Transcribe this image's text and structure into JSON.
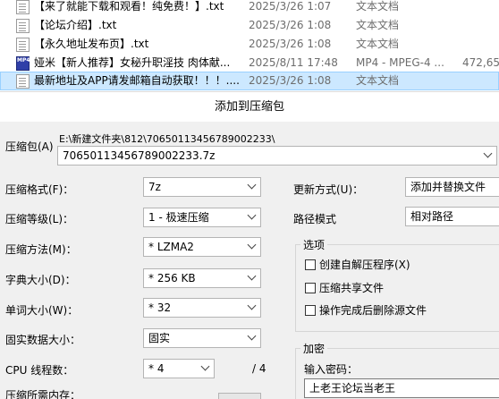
{
  "files": [
    {
      "icon": "text-file-icon",
      "name": "【来了就能下载和观看！纯免费！】.txt",
      "date": "2025/3/26 1:07",
      "type": "文本文档",
      "size": ""
    },
    {
      "icon": "text-file-icon",
      "name": "【论坛介绍】.txt",
      "date": "2025/3/26 1:08",
      "type": "文本文档",
      "size": ""
    },
    {
      "icon": "text-file-icon",
      "name": "【永久地址发布页】.txt",
      "date": "2025/3/26 1:08",
      "type": "文本文档",
      "size": ""
    },
    {
      "icon": "video-file-icon",
      "name": "娅米【新人推荐】女秘升职淫技 肉体献...",
      "date": "2025/8/11 17:48",
      "type": "MP4 - MPEG-4 ...",
      "size": "472,65"
    },
    {
      "icon": "text-file-icon",
      "name": "最新地址及APP请发邮箱自动获取！！！....",
      "date": "2025/3/26 1:08",
      "type": "文本文档",
      "size": ""
    }
  ],
  "mp4_icon_text": "MP4",
  "dialog": {
    "title": "添加到压缩包",
    "archive_label": "压缩包(A)",
    "archive_path": "E:\\新建文件夹\\812\\70650113456789002233\\",
    "archive_name": "70650113456789002233.7z",
    "format_label": "压缩格式(F)：",
    "format_value": "7z",
    "level_label": "压缩等级(L)：",
    "level_value": "1 - 极速压缩",
    "method_label": "压缩方法(M)：",
    "method_value": "* LZMA2",
    "dict_label": "字典大小(D)：",
    "dict_value": "* 256 KB",
    "word_label": "单词大小(W)：",
    "word_value": "* 32",
    "solid_label": "固实数据大小：",
    "solid_value": "固实",
    "threads_label": "CPU 线程数：",
    "threads_value": "* 4",
    "threads_total": "/ 4",
    "memory_label": "压缩所需内存：",
    "update_label": "更新方式(U)：",
    "update_value": "添加并替换文件",
    "path_label": "路径模式",
    "path_value": "相对路径",
    "options_title": "选项",
    "opt_sfx": "创建自解压程序(X)",
    "opt_shared": "压缩共享文件",
    "opt_delete": "操作完成后删除源文件",
    "encrypt_title": "加密",
    "password_label": "输入密码：",
    "password_value": "上老王论坛当老王"
  }
}
